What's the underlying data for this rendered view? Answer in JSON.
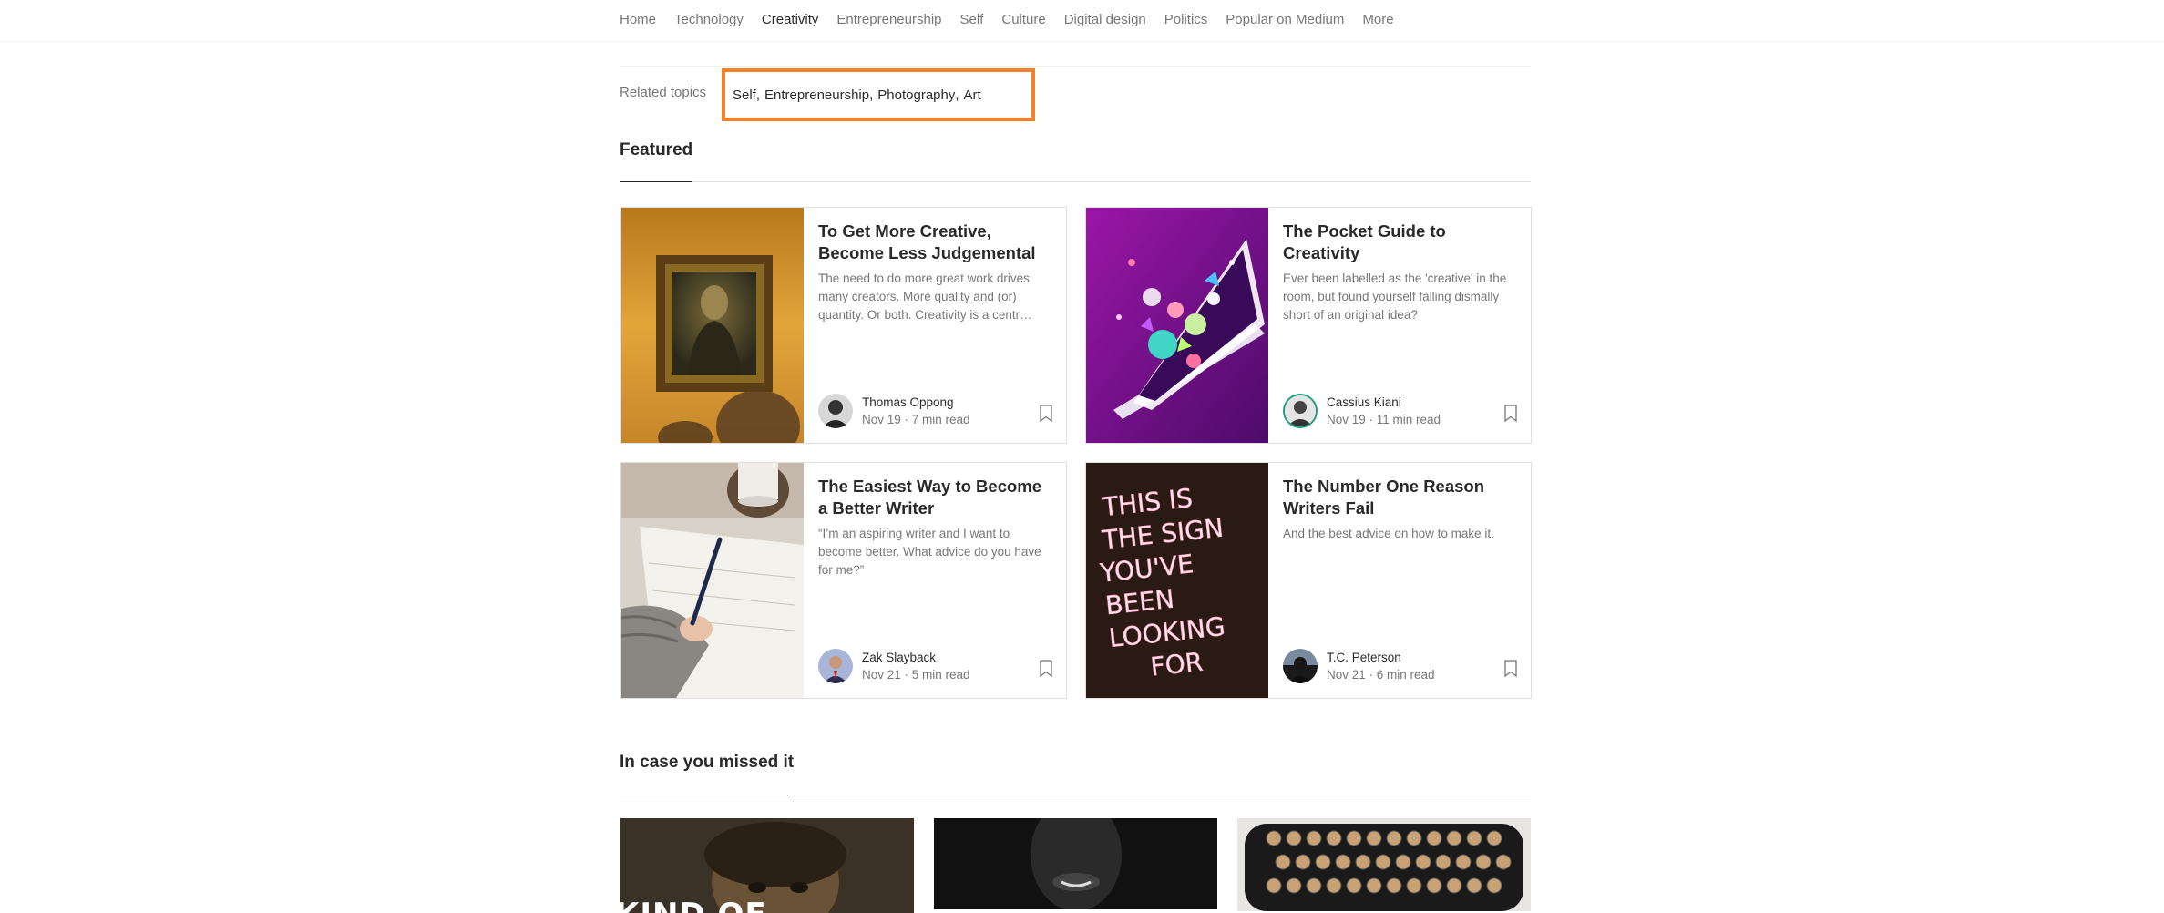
{
  "nav": {
    "items": [
      "Home",
      "Technology",
      "Creativity",
      "Entrepreneurship",
      "Self",
      "Culture",
      "Digital design",
      "Politics",
      "Popular on Medium",
      "More"
    ],
    "active": "Creativity"
  },
  "related": {
    "label": "Related topics",
    "topics": [
      "Self",
      "Entrepreneurship",
      "Photography",
      "Art"
    ],
    "separator": ",",
    "highlight_color": "#f5822a"
  },
  "featured": {
    "heading": "Featured",
    "cards": [
      {
        "title": "To Get More Creative, Become Less Judgemental",
        "subtitle": "The need to do more great work drives many creators. More quality and (or) quantity. Or both. Creativity is a centr…",
        "author": "Thomas Oppong",
        "date": "Nov 19",
        "read": "7 min read",
        "image": "mona-lisa-painting"
      },
      {
        "title": "The Pocket Guide to Creativity",
        "subtitle": "Ever been labelled as the 'creative' in the room, but found yourself falling dismally short of an original idea?",
        "author": "Cassius Kiani",
        "date": "Nov 19",
        "read": "11 min read",
        "image": "purple-laptop-illustration"
      },
      {
        "title": "The Easiest Way to Become a Better Writer",
        "subtitle": "“I’m an aspiring writer and I want to become better. What advice do you have for me?”",
        "author": "Zak Slayback",
        "date": "Nov 21",
        "read": "5 min read",
        "image": "hand-writing-with-pen"
      },
      {
        "title": "The Number One Reason Writers Fail",
        "subtitle": "And the best advice on how to make it.",
        "author": "T.C. Peterson",
        "date": "Nov 21",
        "read": "6 min read",
        "image": "neon-sign",
        "image_text": "THIS IS THE SIGN YOU'VE BEEN LOOKING FOR"
      }
    ]
  },
  "missed": {
    "heading": "In case you missed it",
    "thumb_text": "KIND OF"
  }
}
